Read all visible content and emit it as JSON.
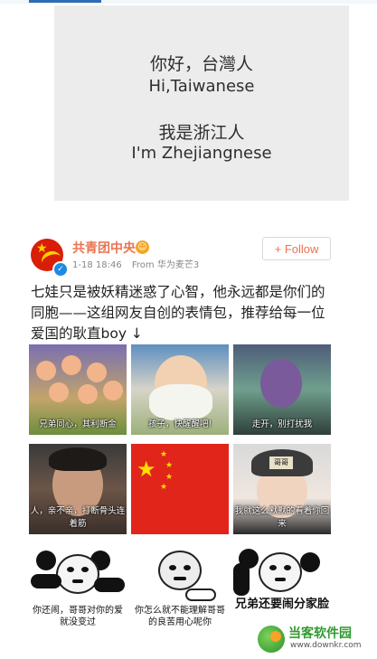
{
  "top_card": {
    "line1": "你好，台灣人",
    "line2": "Hi,Taiwanese",
    "line3": "我是浙江人",
    "line4": "I'm Zhejiangnese"
  },
  "post": {
    "author": "共青团中央",
    "meta_time": "1-18 18:46",
    "meta_source": "From 华为麦芒3",
    "follow_label": "+ Follow",
    "text": "七娃只是被妖精迷惑了心智，他永远都是你们的同胞——这组网友自创的表情包，推荐给每一位爱国的耿直boy ↓",
    "images": [
      {
        "caption": "兄弟同心，其利断金"
      },
      {
        "caption": "孩子，快醒醒吧!"
      },
      {
        "caption": "走开，别打扰我"
      },
      {
        "caption": "人，亲不亲，打断骨头连着筋"
      },
      {
        "caption": ""
      },
      {
        "caption": "我就这么默默的看着你回来"
      },
      {
        "caption": "你还闹，哥哥对你的爱就没变过"
      },
      {
        "caption": "你怎么就不能理解哥哥的良苦用心呢你"
      },
      {
        "caption": "兄弟还要闹分家脸"
      }
    ],
    "hat_text": "哥哥"
  },
  "watermark": {
    "name": "当客软件园",
    "url": "www.downkr.com"
  }
}
